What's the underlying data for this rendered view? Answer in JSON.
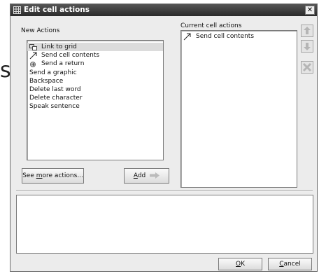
{
  "stray_text": "s",
  "dialog": {
    "title": "Edit cell actions",
    "close_glyph": "✕"
  },
  "new_actions": {
    "label": "New Actions",
    "items": [
      {
        "label": "Link to grid",
        "icon": "link-grid-icon",
        "selected": true
      },
      {
        "label": "Send cell contents",
        "icon": "arrow-icon",
        "selected": false
      },
      {
        "label": "Send a return",
        "icon": "return-icon",
        "selected": false
      },
      {
        "label": "Send a graphic",
        "icon": "",
        "selected": false
      },
      {
        "label": "Backspace",
        "icon": "",
        "selected": false
      },
      {
        "label": "Delete last word",
        "icon": "",
        "selected": false
      },
      {
        "label": "Delete character",
        "icon": "",
        "selected": false
      },
      {
        "label": "Speak sentence",
        "icon": "",
        "selected": false
      }
    ]
  },
  "buttons": {
    "see_more_pre": "See ",
    "see_more_mnemonic": "m",
    "see_more_post": "ore actions...",
    "add_mnemonic": "A",
    "add_post": "dd",
    "ok_mnemonic": "O",
    "ok_post": "K",
    "cancel_mnemonic": "C",
    "cancel_post": "ancel"
  },
  "current_actions": {
    "label": "Current cell actions",
    "items": [
      {
        "label": "Send cell contents",
        "icon": "arrow-icon"
      }
    ]
  },
  "side_buttons": {
    "move_up_icon": "arrow-up-icon",
    "move_down_icon": "arrow-down-icon",
    "delete_icon": "x-icon"
  },
  "colors": {
    "title_bar": "#3a3a3a",
    "selection": "#dcdcdc",
    "disabled_icon": "#b5b5b5"
  }
}
